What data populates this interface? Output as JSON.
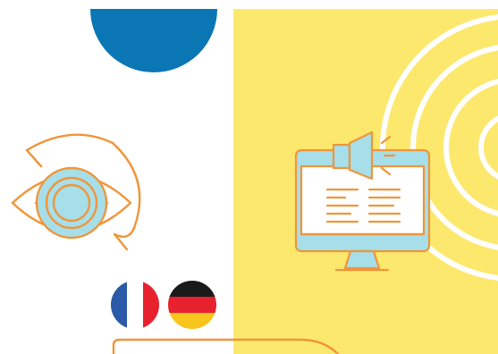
{
  "palette": {
    "background": "#ffffff",
    "yellow_panel": "#fde86e",
    "blue_circle": "#0a76b4",
    "orange_stroke": "#f0953a",
    "light_blue": "#a6dfe9",
    "ring_white": "#ffffff",
    "flag_blue": "#2a5aa8",
    "flag_white": "#ffffff",
    "flag_red": "#e7222e",
    "flag_black": "#1a1a1a",
    "flag_gold": "#f7c51b"
  },
  "illustrations": [
    {
      "icon": "blue-half-circle-icon"
    },
    {
      "icon": "concentric-rings-icon"
    },
    {
      "icon": "eye-icon"
    },
    {
      "icon": "monitor-megaphone-icon"
    },
    {
      "icon": "france-flag-icon"
    },
    {
      "icon": "germany-flag-icon"
    },
    {
      "icon": "rounded-frame-icon"
    }
  ]
}
